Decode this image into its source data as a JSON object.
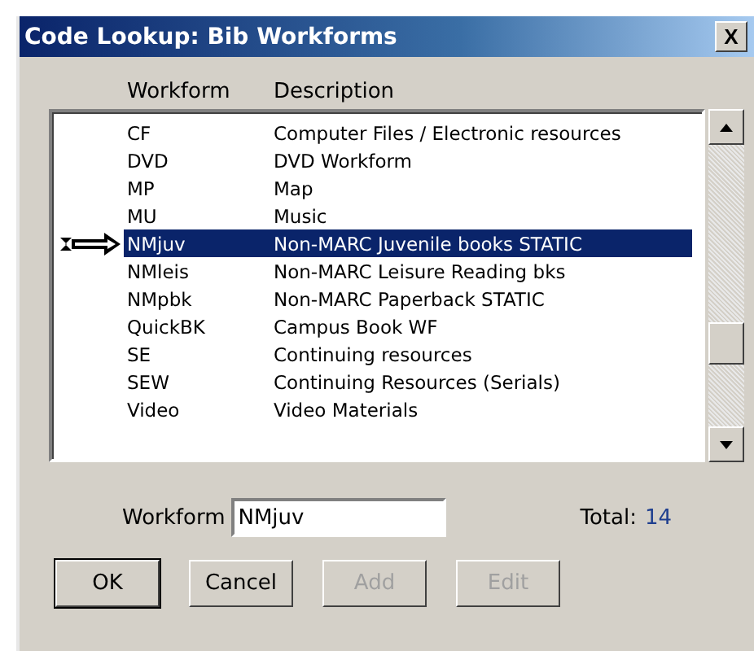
{
  "window": {
    "title": "Code Lookup: Bib Workforms",
    "close": "X"
  },
  "table": {
    "columns": [
      "Workform",
      "Description"
    ],
    "rows": [
      {
        "workform": "CF",
        "description": "Computer Files / Electronic resources",
        "selected": false
      },
      {
        "workform": "DVD",
        "description": "DVD Workform",
        "selected": false
      },
      {
        "workform": "MP",
        "description": "Map",
        "selected": false
      },
      {
        "workform": "MU",
        "description": "Music",
        "selected": false
      },
      {
        "workform": "NMjuv",
        "description": "Non-MARC Juvenile books STATIC",
        "selected": true
      },
      {
        "workform": "NMleis",
        "description": "Non-MARC Leisure Reading bks",
        "selected": false
      },
      {
        "workform": "NMpbk",
        "description": "Non-MARC Paperback STATIC",
        "selected": false
      },
      {
        "workform": "QuickBK",
        "description": "Campus Book WF",
        "selected": false
      },
      {
        "workform": "SE",
        "description": "Continuing resources",
        "selected": false
      },
      {
        "workform": "SEW",
        "description": "Continuing Resources (Serials)",
        "selected": false
      },
      {
        "workform": "Video",
        "description": "Video Materials",
        "selected": false
      }
    ]
  },
  "workform_field": {
    "label": "Workform",
    "value": "NMjuv"
  },
  "total": {
    "label": "Total:",
    "value": "14"
  },
  "buttons": [
    {
      "label": "OK",
      "disabled": false,
      "default": true
    },
    {
      "label": "Cancel",
      "disabled": false,
      "default": false
    },
    {
      "label": "Add",
      "disabled": true,
      "default": false
    },
    {
      "label": "Edit",
      "disabled": true,
      "default": false
    }
  ]
}
